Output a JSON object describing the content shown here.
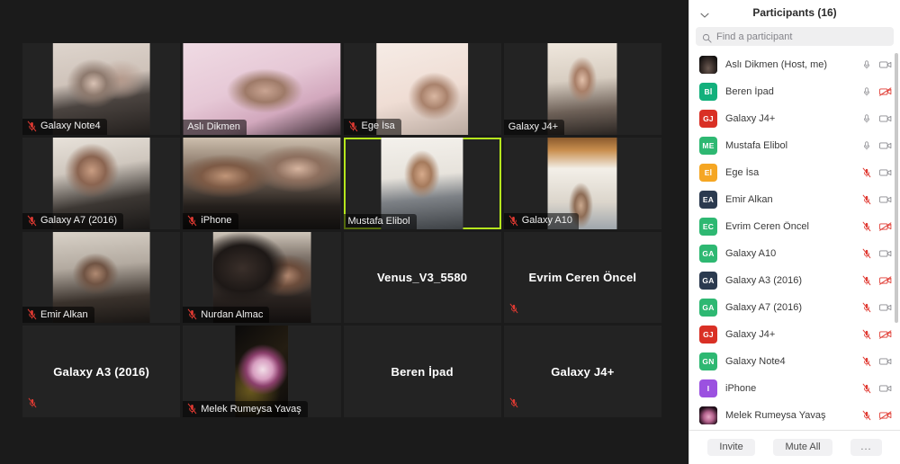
{
  "sidebar": {
    "title": "Participants (16)",
    "collapse_icon": "chevron-down-icon",
    "search": {
      "placeholder": "Find a participant",
      "value": "",
      "icon": "search-icon"
    },
    "participants": [
      {
        "name": "Aslı Dikmen (Host, me)",
        "initials": "",
        "avatar_type": "photo",
        "avatar_color": "#171717",
        "mic": "mic-on",
        "camera": "camera-on"
      },
      {
        "name": "Beren İpad",
        "initials": "Bİ",
        "avatar_type": "initials",
        "avatar_color": "#13b07c",
        "mic": "mic-on",
        "camera": "camera-off"
      },
      {
        "name": "Galaxy J4+",
        "initials": "GJ",
        "avatar_type": "initials",
        "avatar_color": "#d93025",
        "mic": "mic-on",
        "camera": "camera-on"
      },
      {
        "name": "Mustafa Elibol",
        "initials": "ME",
        "avatar_type": "initials",
        "avatar_color": "#2eb872",
        "mic": "mic-on",
        "camera": "camera-on"
      },
      {
        "name": "Ege İsa",
        "initials": "Eİ",
        "avatar_type": "initials",
        "avatar_color": "#f5a623",
        "mic": "mic-off",
        "camera": "camera-on"
      },
      {
        "name": "Emir Alkan",
        "initials": "EA",
        "avatar_type": "initials",
        "avatar_color": "#2b3a4f",
        "mic": "mic-off",
        "camera": "camera-on"
      },
      {
        "name": "Evrim Ceren Öncel",
        "initials": "EC",
        "avatar_type": "initials",
        "avatar_color": "#2eb872",
        "mic": "mic-off",
        "camera": "camera-off"
      },
      {
        "name": "Galaxy A10",
        "initials": "GA",
        "avatar_type": "initials",
        "avatar_color": "#2eb872",
        "mic": "mic-off",
        "camera": "camera-on"
      },
      {
        "name": "Galaxy A3 (2016)",
        "initials": "GA",
        "avatar_type": "initials",
        "avatar_color": "#2b3a4f",
        "mic": "mic-off",
        "camera": "camera-off"
      },
      {
        "name": "Galaxy A7 (2016)",
        "initials": "GA",
        "avatar_type": "initials",
        "avatar_color": "#2eb872",
        "mic": "mic-off",
        "camera": "camera-on"
      },
      {
        "name": "Galaxy J4+",
        "initials": "GJ",
        "avatar_type": "initials",
        "avatar_color": "#d93025",
        "mic": "mic-off",
        "camera": "camera-off"
      },
      {
        "name": "Galaxy Note4",
        "initials": "GN",
        "avatar_type": "initials",
        "avatar_color": "#2eb872",
        "mic": "mic-off",
        "camera": "camera-on"
      },
      {
        "name": "iPhone",
        "initials": "I",
        "avatar_type": "initials",
        "avatar_color": "#9b51e0",
        "mic": "mic-off",
        "camera": "camera-on"
      },
      {
        "name": "Melek Rumeysa Yavaş",
        "initials": "",
        "avatar_type": "photo2",
        "avatar_color": "#171717",
        "mic": "mic-off",
        "camera": "camera-off"
      }
    ],
    "footer": {
      "invite": "Invite",
      "mute_all": "Mute All",
      "more": "..."
    }
  },
  "stage": {
    "active_speaker_color": "#b5e61d",
    "tiles": [
      {
        "name": "Galaxy Note4",
        "label_position": "bottom-left",
        "muted": true,
        "camera": "on",
        "active": false,
        "video_width": "w62",
        "scene": "scene-a"
      },
      {
        "name": "Aslı Dikmen",
        "label_position": "bottom-left",
        "muted": false,
        "camera": "on",
        "active": false,
        "video_width": "wide",
        "scene": "scene-b"
      },
      {
        "name": "Ege İsa",
        "label_position": "bottom-left",
        "muted": true,
        "camera": "on",
        "active": false,
        "video_width": "w58",
        "scene": "scene-c"
      },
      {
        "name": "Galaxy J4+",
        "label_position": "bottom-left",
        "muted": false,
        "camera": "on",
        "active": false,
        "video_width": "w44",
        "scene": "scene-d"
      },
      {
        "name": "Galaxy A7 (2016)",
        "label_position": "bottom-left",
        "muted": true,
        "camera": "on",
        "active": false,
        "video_width": "w62",
        "scene": "scene-e"
      },
      {
        "name": "iPhone",
        "label_position": "bottom-left",
        "muted": true,
        "camera": "on",
        "active": false,
        "video_width": "wide",
        "scene": "scene-f"
      },
      {
        "name": "Mustafa Elibol",
        "label_position": "bottom-left",
        "muted": false,
        "camera": "on",
        "active": true,
        "video_width": "w52",
        "scene": "scene-g"
      },
      {
        "name": "Galaxy A10",
        "label_position": "bottom-left",
        "muted": true,
        "camera": "on",
        "active": false,
        "video_width": "w44",
        "scene": "scene-h"
      },
      {
        "name": "Emir Alkan",
        "label_position": "bottom-left",
        "muted": true,
        "camera": "on",
        "active": false,
        "video_width": "w62",
        "scene": "scene-i"
      },
      {
        "name": "Nurdan Almac",
        "label_position": "bottom-left",
        "muted": true,
        "camera": "on",
        "active": false,
        "video_width": "w62",
        "scene": "scene-j"
      },
      {
        "name": "Venus_V3_5580",
        "label_position": "center",
        "muted": false,
        "camera": "off",
        "active": false,
        "video_width": "",
        "scene": ""
      },
      {
        "name": "Evrim Ceren Öncel",
        "label_position": "center",
        "muted": true,
        "camera": "off",
        "active": false,
        "video_width": "",
        "scene": ""
      },
      {
        "name": "Galaxy A3 (2016)",
        "label_position": "center",
        "muted": true,
        "camera": "off",
        "active": false,
        "video_width": "",
        "scene": ""
      },
      {
        "name": "Melek Rumeysa Yavaş",
        "label_position": "bottom-left",
        "muted": true,
        "camera": "on",
        "active": false,
        "video_width": "w34",
        "scene": "scene-k"
      },
      {
        "name": "Beren İpad",
        "label_position": "center",
        "muted": false,
        "camera": "off",
        "active": false,
        "video_width": "",
        "scene": ""
      },
      {
        "name": "Galaxy J4+",
        "label_position": "center",
        "muted": true,
        "camera": "off",
        "active": false,
        "video_width": "",
        "scene": ""
      }
    ]
  }
}
